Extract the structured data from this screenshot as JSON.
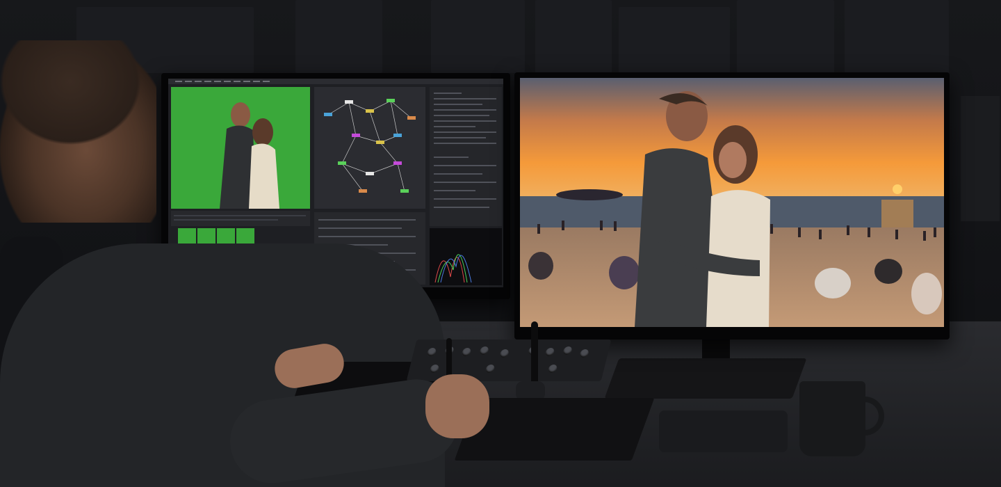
{
  "scene": {
    "description_free": true
  },
  "left_monitor": {
    "app": "compositing-ui",
    "viewer_color": "#3aa83a",
    "node_colors": [
      "#d9c24a",
      "#4aa3d9",
      "#5ad15a",
      "#c44ad9",
      "#d98a4a",
      "#e6e6e6"
    ]
  },
  "right_monitor": {
    "sky_top": "#5a5f70",
    "sky_sunset": "#f59a3a",
    "sun_color": "#ffcf6a",
    "sea_color": "#4f5a6a",
    "sand_color": "#b38a6a"
  },
  "desk": {
    "mug_color": "#18191b"
  }
}
